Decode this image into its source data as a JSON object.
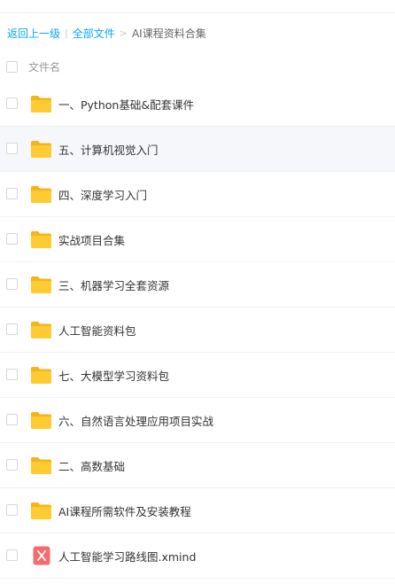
{
  "breadcrumb": {
    "back": "返回上一级",
    "divider": "|",
    "all_files": "全部文件",
    "separator": ">",
    "current": "AI课程资料合集"
  },
  "list_header": {
    "name_column": "文件名"
  },
  "colors": {
    "link": "#06a7ff",
    "folder": "#ffcb32",
    "folder_back": "#f5b417",
    "mind_icon": "#f46d6d",
    "row_highlight": "#f5f7fb"
  },
  "files": [
    {
      "name": "一、Python基础&配套课件",
      "icon": "folder-icon"
    },
    {
      "name": "五、计算机视觉入门",
      "icon": "folder-icon"
    },
    {
      "name": "四、深度学习入门",
      "icon": "folder-icon"
    },
    {
      "name": "实战项目合集",
      "icon": "folder-icon"
    },
    {
      "name": "三、机器学习全套资源",
      "icon": "folder-icon"
    },
    {
      "name": "人工智能资料包",
      "icon": "folder-icon"
    },
    {
      "name": "七、大模型学习资料包",
      "icon": "folder-icon"
    },
    {
      "name": "六、自然语言处理应用项目实战",
      "icon": "folder-icon"
    },
    {
      "name": "二、高数基础",
      "icon": "folder-icon"
    },
    {
      "name": "AI课程所需软件及安装教程",
      "icon": "folder-icon"
    },
    {
      "name": "人工智能学习路线图.xmind",
      "icon": "xmind-file-icon"
    }
  ]
}
